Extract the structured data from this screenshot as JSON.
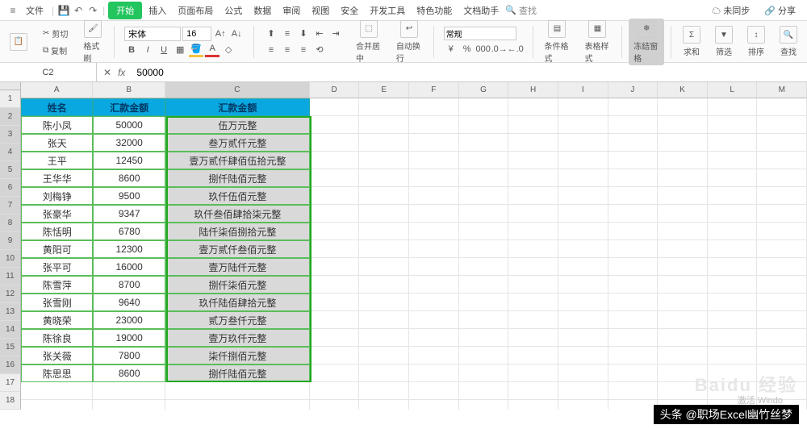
{
  "menu": {
    "items": [
      "文件",
      "开始",
      "插入",
      "页面布局",
      "公式",
      "数据",
      "审阅",
      "视图",
      "安全",
      "开发工具",
      "特色功能",
      "文档助手"
    ],
    "active_index": 1,
    "search_placeholder": "查找",
    "right_items": [
      "未同步",
      "分享"
    ]
  },
  "ribbon": {
    "cut": "剪切",
    "copy": "复制",
    "paste": "粘贴",
    "format_painter": "格式刷",
    "font_name": "宋体",
    "font_size": "16",
    "merge": "合并居中",
    "wrap": "自动换行",
    "number_format": "常规",
    "conditional": "条件格式",
    "cell_style": "表格样式",
    "lock": "冻结窗格",
    "sum": "求和",
    "filter": "筛选",
    "sort": "排序",
    "find": "查找"
  },
  "name_box": "C2",
  "formula_value": "50000",
  "columns": [
    "A",
    "B",
    "C",
    "D",
    "E",
    "F",
    "G",
    "H",
    "I",
    "J",
    "K",
    "L",
    "M"
  ],
  "headers": {
    "A": "姓名",
    "B": "汇款金额",
    "C": "汇款金额"
  },
  "rows": [
    {
      "A": "陈小凤",
      "B": "50000",
      "C": "伍万元整"
    },
    {
      "A": "张天",
      "B": "32000",
      "C": "叁万贰仟元整"
    },
    {
      "A": "王平",
      "B": "12450",
      "C": "壹万贰仟肆佰伍拾元整"
    },
    {
      "A": "王华华",
      "B": "8600",
      "C": "捌仟陆佰元整"
    },
    {
      "A": "刘梅铮",
      "B": "9500",
      "C": "玖仟伍佰元整"
    },
    {
      "A": "张豪华",
      "B": "9347",
      "C": "玖仟叁佰肆拾柒元整"
    },
    {
      "A": "陈恬明",
      "B": "6780",
      "C": "陆仟柒佰捌拾元整"
    },
    {
      "A": "黄阳可",
      "B": "12300",
      "C": "壹万贰仟叁佰元整"
    },
    {
      "A": "张平可",
      "B": "16000",
      "C": "壹万陆仟元整"
    },
    {
      "A": "陈雪萍",
      "B": "8700",
      "C": "捌仟柒佰元整"
    },
    {
      "A": "张雪刚",
      "B": "9640",
      "C": "玖仟陆佰肆拾元整"
    },
    {
      "A": "黄晓荣",
      "B": "23000",
      "C": "贰万叁仟元整"
    },
    {
      "A": "陈徐良",
      "B": "19000",
      "C": "壹万玖仟元整"
    },
    {
      "A": "张关薇",
      "B": "7800",
      "C": "柒仟捌佰元整"
    },
    {
      "A": "陈思思",
      "B": "8600",
      "C": "捌仟陆佰元整"
    }
  ],
  "watermark": "Baidu 经验",
  "activate_text": "激活 Windo",
  "footer": "头条 @职场Excel幽竹丝梦"
}
